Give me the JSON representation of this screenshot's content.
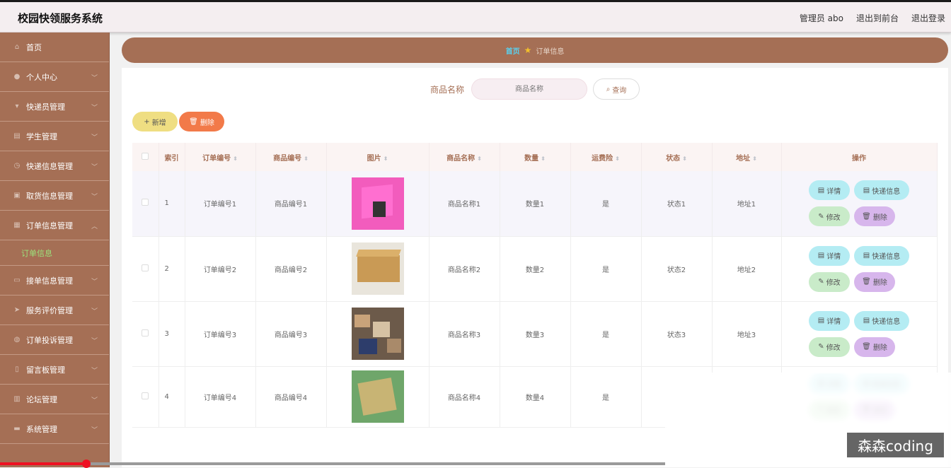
{
  "app": {
    "title": "校园快领服务系统"
  },
  "topbar": {
    "user": "管理员 abo",
    "front": "退出到前台",
    "logout": "退出登录"
  },
  "sidebar": {
    "items": [
      {
        "label": "首页",
        "icon": "home-icon",
        "chevron": false
      },
      {
        "label": "个人中心",
        "icon": "user-icon",
        "chevron": true
      },
      {
        "label": "快递员管理",
        "icon": "courier-icon",
        "chevron": true
      },
      {
        "label": "学生管理",
        "icon": "student-icon",
        "chevron": true
      },
      {
        "label": "快递信息管理",
        "icon": "compass-icon",
        "chevron": true
      },
      {
        "label": "取货信息管理",
        "icon": "pickup-icon",
        "chevron": true
      },
      {
        "label": "订单信息管理",
        "icon": "order-icon",
        "chevron": true,
        "expanded": true
      },
      {
        "label": "接单信息管理",
        "icon": "message-icon",
        "chevron": true
      },
      {
        "label": "服务评价管理",
        "icon": "send-icon",
        "chevron": true
      },
      {
        "label": "订单投诉管理",
        "icon": "globe-icon",
        "chevron": true
      },
      {
        "label": "留言板管理",
        "icon": "board-icon",
        "chevron": true
      },
      {
        "label": "论坛管理",
        "icon": "forum-icon",
        "chevron": true
      },
      {
        "label": "系统管理",
        "icon": "system-icon",
        "chevron": true
      }
    ],
    "submenu": {
      "label": "订单信息"
    }
  },
  "breadcrumb": {
    "home": "首页",
    "current": "订单信息"
  },
  "search": {
    "label": "商品名称",
    "placeholder": "商品名称",
    "button": "查询"
  },
  "actions": {
    "add": "新增",
    "delete": "删除"
  },
  "table": {
    "headers": [
      "索引",
      "订单编号",
      "商品编号",
      "图片",
      "商品名称",
      "数量",
      "运费险",
      "状态",
      "地址",
      "操作"
    ],
    "rows": [
      {
        "index": "1",
        "order_no": "订单编号1",
        "goods_no": "商品编号1",
        "image": "pink-box",
        "goods_name": "商品名称1",
        "qty": "数量1",
        "insurance": "是",
        "status": "状态1",
        "address": "地址1"
      },
      {
        "index": "2",
        "order_no": "订单编号2",
        "goods_no": "商品编号2",
        "image": "brown-box",
        "goods_name": "商品名称2",
        "qty": "数量2",
        "insurance": "是",
        "status": "状态2",
        "address": "地址2"
      },
      {
        "index": "3",
        "order_no": "订单编号3",
        "goods_no": "商品编号3",
        "image": "parcel-pile",
        "goods_name": "商品名称3",
        "qty": "数量3",
        "insurance": "是",
        "status": "状态3",
        "address": "地址3"
      },
      {
        "index": "4",
        "order_no": "订单编号4",
        "goods_no": "商品编号4",
        "image": "box-on-green",
        "goods_name": "商品名称4",
        "qty": "数量4",
        "insurance": "是",
        "status": "",
        "address": ""
      }
    ],
    "ops": {
      "detail": "详情",
      "express": "快递信息",
      "edit": "修改",
      "delete": "删除"
    }
  },
  "watermark": "森森coding",
  "colors": {
    "sidebar": "#a56f55",
    "accent_blue": "#5ad0ee",
    "submenu_active": "#9be37c",
    "delete": "#f27a49",
    "add": "#efde82"
  }
}
